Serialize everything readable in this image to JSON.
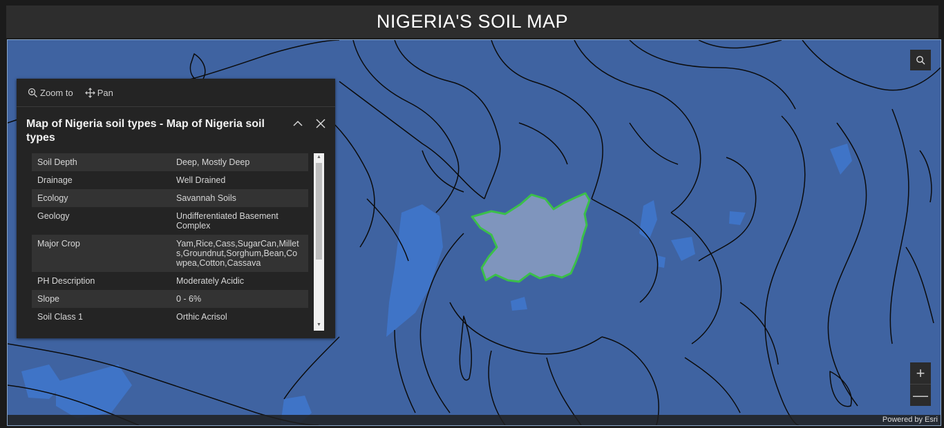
{
  "header": {
    "title": "NIGERIA'S SOIL MAP"
  },
  "colors": {
    "map_background": "#3f63a1",
    "highlight_outline": "#3bbf4a",
    "highlight_fill": "#7f95bd",
    "lighter_soil": "#3f73c6"
  },
  "icons": {
    "search": "search-icon",
    "zoom_in": "plus-icon",
    "zoom_out": "minus-icon",
    "close": "close-icon",
    "collapse": "chevron-up-icon",
    "zoom_to": "zoom-to-icon",
    "pan": "pan-icon"
  },
  "popup": {
    "actions": {
      "zoom_to_label": "Zoom to",
      "pan_label": "Pan"
    },
    "title": "Map of Nigeria soil types - Map of Nigeria soil types",
    "attributes": [
      {
        "key": "Soil Depth",
        "value": "Deep, Mostly Deep"
      },
      {
        "key": "Drainage",
        "value": "Well Drained"
      },
      {
        "key": "Ecology",
        "value": "Savannah Soils"
      },
      {
        "key": "Geology",
        "value": "Undifferentiated Basement Complex"
      },
      {
        "key": "Major Crop",
        "value": "Yam,Rice,Cass,SugarCan,Millets,Groundnut,Sorghum,Bean,Cowpea,Cotton,Cassava"
      },
      {
        "key": "PH Description",
        "value": "Moderately Acidic"
      },
      {
        "key": "Slope",
        "value": "0 - 6%"
      },
      {
        "key": "Soil Class 1",
        "value": "Orthic Acrisol"
      }
    ]
  },
  "map": {
    "zoom_in_label": "+",
    "zoom_out_label": "—",
    "attribution": "Powered by Esri"
  }
}
